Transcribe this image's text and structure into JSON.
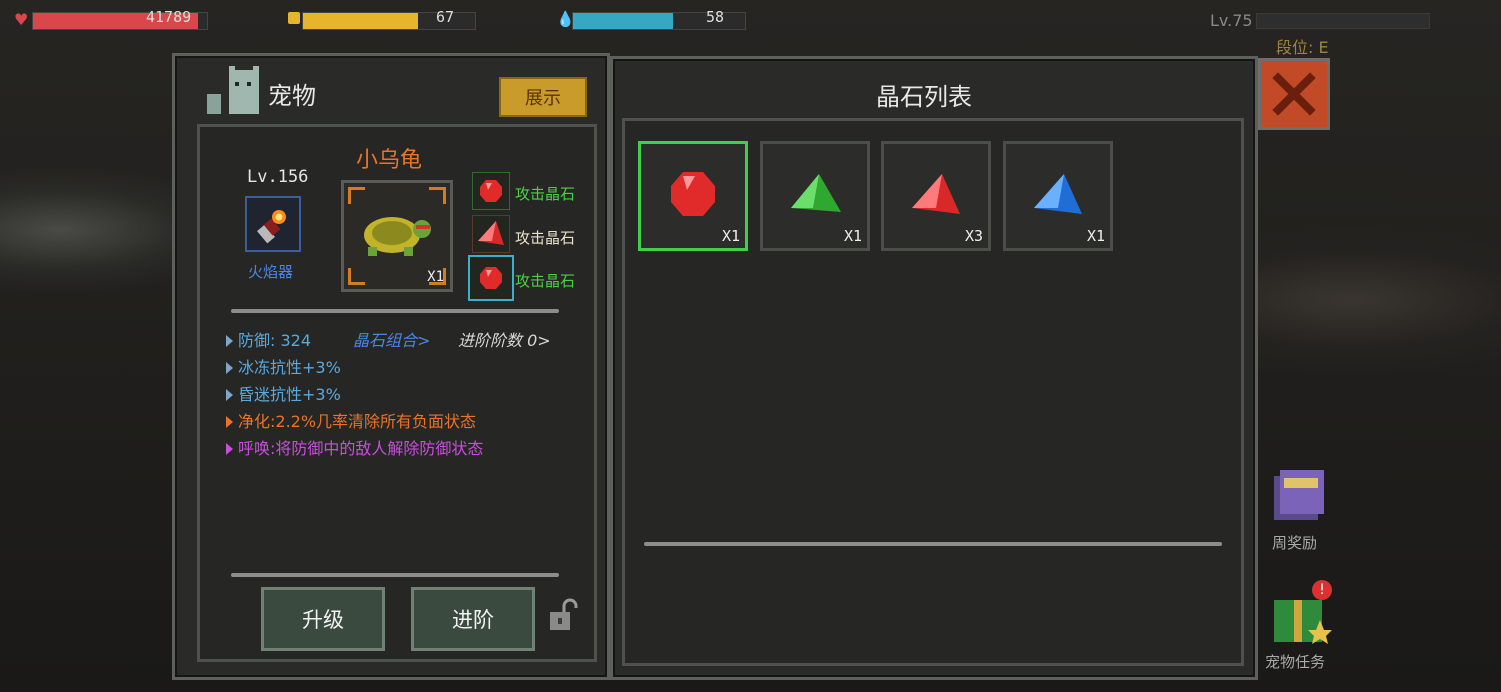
{
  "top_bar": {
    "hp": {
      "value": "41789",
      "fill": 0.95,
      "color": "#d9474a"
    },
    "food": {
      "value": "67",
      "fill": 0.67,
      "color": "#e7b52b"
    },
    "water": {
      "value": "58",
      "fill": 0.58,
      "color": "#36a8c2"
    },
    "level": "Lv.75",
    "rank": "段位: E"
  },
  "pet_panel": {
    "title": "宠物",
    "show_button": "展示",
    "equip_level": "Lv.156",
    "equip_name": "火焰器",
    "pet_name": "小乌龟",
    "pet_qty": "X1",
    "gem_slots": [
      {
        "label": "攻击晶石",
        "icon": "red-gem-icon",
        "label_color": "#4ccf45"
      },
      {
        "label": "攻击晶石",
        "icon": "red-crystal-icon",
        "label_color": "#e8e0c8"
      },
      {
        "label": "攻击晶石",
        "icon": "red-gem-icon",
        "label_color": "#4ccf45"
      }
    ],
    "stats": {
      "defense": "防御: 324",
      "crystal_combo": "晶石组合>",
      "advance_count": "进阶阶数 0>",
      "freeze_resist": "冰冻抗性+3%",
      "stun_resist": "昏迷抗性+3%",
      "purify": "净化:2.2%几率清除所有负面状态",
      "summon": "呼唤:将防御中的敌人解除防御状态"
    },
    "upgrade_button": "升级",
    "advance_button": "进阶"
  },
  "crystal_panel": {
    "title": "晶石列表",
    "items": [
      {
        "icon": "red-gem-icon",
        "qty": "X1",
        "selected": true
      },
      {
        "icon": "green-crystal-icon",
        "qty": "X1",
        "selected": false
      },
      {
        "icon": "red-crystal-icon",
        "qty": "X3",
        "selected": false
      },
      {
        "icon": "blue-crystal-icon",
        "qty": "X1",
        "selected": false
      }
    ]
  },
  "side": {
    "weekly_reward": "周奖励",
    "pet_task": "宠物任务"
  },
  "colors": {
    "accent": "#c99b2a",
    "close": "#c24a26",
    "selected": "#3ed04a"
  }
}
